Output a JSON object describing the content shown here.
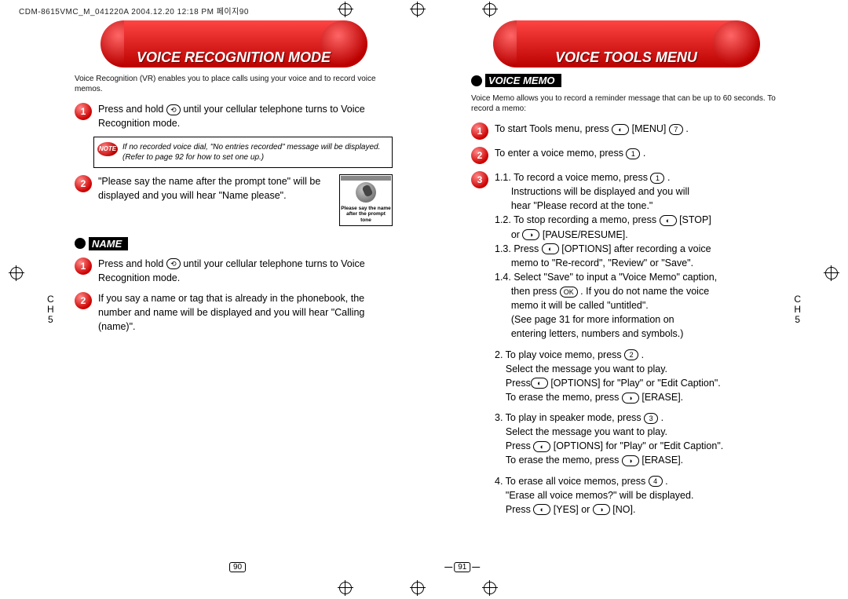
{
  "header_raw": "CDM-8615VMC_M_041220A  2004.12.20 12:18 PM  페이지90",
  "left": {
    "pill_title": "VOICE RECOGNITION MODE",
    "intro": "Voice Recognition (VR) enables you to place calls using your voice and to record voice memos.",
    "step1": "Press and hold        until your cellular telephone turns to Voice Recognition mode.",
    "note": "If no recorded voice dial, \"No entries recorded\" message will be displayed. (Refer to page 92 for how to set one up.)",
    "step2": "\"Please say the name after the prompt tone\" will be displayed and you will hear \"Name please\".",
    "screen_caption": "Please say the name after the prompt tone",
    "section_name": "NAME",
    "name_step1": "Press and hold        until your cellular telephone turns to Voice Recognition mode.",
    "name_step2": "If you say a name or tag that is already in the phonebook, the number and name will be displayed and you will hear \"Calling (name)\".",
    "page_number": "90",
    "ch_label_1": "C",
    "ch_label_2": "H",
    "ch_label_3": "5"
  },
  "right": {
    "pill_title": "VOICE TOOLS MENU",
    "section_memo": "VOICE MEMO",
    "intro": "Voice Memo allows you to record a reminder message that can be up to 60 seconds.  To record a memo:",
    "step1": "To start Tools menu, press      [MENU]      .",
    "step2": "To enter a voice memo, press      .",
    "step3_11": "1.1. To record a voice memo, press      . Instructions will be displayed and you will hear \"Please record at the tone.\"",
    "step3_12": "1.2. To stop recording a memo, press      [STOP] or      [PAUSE/RESUME].",
    "step3_13": "1.3. Press      [OPTIONS] after recording a voice memo to \"Re-record\", \"Review\" or \"Save\".",
    "step3_14": "1.4. Select \"Save\" to input a \"Voice Memo\" caption, then press      .  If you do not name the voice memo it will be called \"untitled\". (See page 31 for more information on entering letters, numbers and symbols.)",
    "para2": "2. To play voice memo, press      . Select the message you want to play. Press     [OPTIONS] for \"Play\" or \"Edit Caption\". To erase the memo, press      [ERASE].",
    "para3": "3. To play in speaker mode, press      . Select the message you want to play. Press      [OPTIONS] for \"Play\" or \"Edit Caption\". To erase the memo, press      [ERASE].",
    "para4": "4. To erase all voice memos, press      . \"Erase all voice memos?\" will be displayed. Press      [YES] or      [NO].",
    "page_number": "91",
    "ch_label_1": "C",
    "ch_label_2": "H",
    "ch_label_3": "5"
  }
}
